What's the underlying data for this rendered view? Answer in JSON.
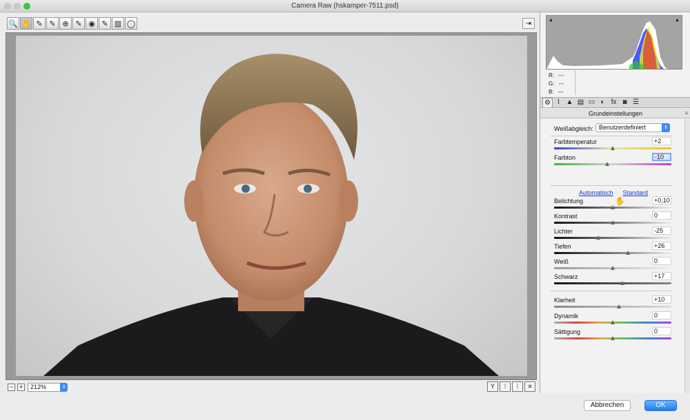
{
  "window": {
    "title": "Camera Raw (hskamper-7511.psd)"
  },
  "toolbar": {
    "tools": [
      {
        "name": "zoom-tool",
        "glyph": "🔍"
      },
      {
        "name": "hand-tool",
        "glyph": "✋"
      },
      {
        "name": "white-balance-tool",
        "glyph": "✎"
      },
      {
        "name": "color-sampler-tool",
        "glyph": "✎"
      },
      {
        "name": "targeted-adjustment-tool",
        "glyph": "⊕"
      },
      {
        "name": "spot-removal-tool",
        "glyph": "✎"
      },
      {
        "name": "red-eye-tool",
        "glyph": "◉"
      },
      {
        "name": "adjustment-brush-tool",
        "glyph": "✎"
      },
      {
        "name": "graduated-filter-tool",
        "glyph": "▥"
      },
      {
        "name": "radial-filter-tool",
        "glyph": "◯"
      }
    ],
    "fullscreen_glyph": "⇥"
  },
  "status": {
    "zoom_out": "−",
    "zoom_in": "+",
    "zoom_value": "212%",
    "zoom_arrow": "⇕",
    "view_buttons": [
      "Y",
      "⁞",
      "⁞",
      "≡"
    ]
  },
  "histogram": {
    "clip_shadow": "▲",
    "clip_highlight": "▲",
    "r_label": "R:",
    "r_value": "---",
    "g_label": "G:",
    "g_value": "---",
    "b_label": "B:",
    "b_value": "---"
  },
  "tabs": [
    "⚙",
    "⌇",
    "▲",
    "▤",
    "▭",
    "◐",
    "fx",
    "◙",
    "☰"
  ],
  "panel": {
    "title": "Grundeinstellungen",
    "menu": "≡",
    "wb_label": "Weißabgleich:",
    "wb_value": "Benutzerdefiniert",
    "wb_arrow": "⇕",
    "auto_link": "Automatisch",
    "default_link": "Standard",
    "sliders": [
      {
        "id": "farbtemperatur",
        "label": "Farbtemperatur",
        "value": "+2",
        "pos": 0.5,
        "gradient": "linear-gradient(to right, #2c3ddb, #e8e8a0, #e8c320)"
      },
      {
        "id": "farbton",
        "label": "Farbton",
        "value": "-10",
        "pos": 0.45,
        "gradient": "linear-gradient(to right, #3cb43c, #d0d0d0, #c83cc8)",
        "focus": true
      },
      {
        "id": "belichtung",
        "label": "Belichtung",
        "value": "+0,10",
        "pos": 0.5,
        "gradient": "linear-gradient(to right, #111, #777, #eee)"
      },
      {
        "id": "kontrast",
        "label": "Kontrast",
        "value": "0",
        "pos": 0.5,
        "gradient": "linear-gradient(to right, #111, #777, #eee)"
      },
      {
        "id": "lichter",
        "label": "Lichter",
        "value": "-25",
        "pos": 0.375,
        "gradient": "linear-gradient(to right, #111, #777, #eee)"
      },
      {
        "id": "tiefen",
        "label": "Tiefen",
        "value": "+26",
        "pos": 0.63,
        "gradient": "linear-gradient(to right, #111, #777, #eee)"
      },
      {
        "id": "weiss",
        "label": "Weiß",
        "value": "0",
        "pos": 0.5,
        "gradient": "linear-gradient(to right, #999, #eee)"
      },
      {
        "id": "schwarz",
        "label": "Schwarz",
        "value": "+17",
        "pos": 0.585,
        "gradient": "linear-gradient(to right, #111, #888)"
      },
      {
        "id": "klarheit",
        "label": "Klarheit",
        "value": "+10",
        "pos": 0.55,
        "gradient": "linear-gradient(to right, #888, #ddd)"
      },
      {
        "id": "dynamik",
        "label": "Dynamik",
        "value": "0",
        "pos": 0.5,
        "gradient": "linear-gradient(to right, #aaa, #e04040, #e0b040, #60c060, #4080e0, #b040e0)"
      },
      {
        "id": "saettigung",
        "label": "Sättigung",
        "value": "0",
        "pos": 0.5,
        "gradient": "linear-gradient(to right, #aaa, #e04040, #e0b040, #60c060, #4080e0, #b040e0)"
      }
    ]
  },
  "buttons": {
    "cancel": "Abbrechen",
    "ok": "OK"
  },
  "colors": {
    "accent": "#3b8cf5",
    "link": "#1a37c8"
  }
}
